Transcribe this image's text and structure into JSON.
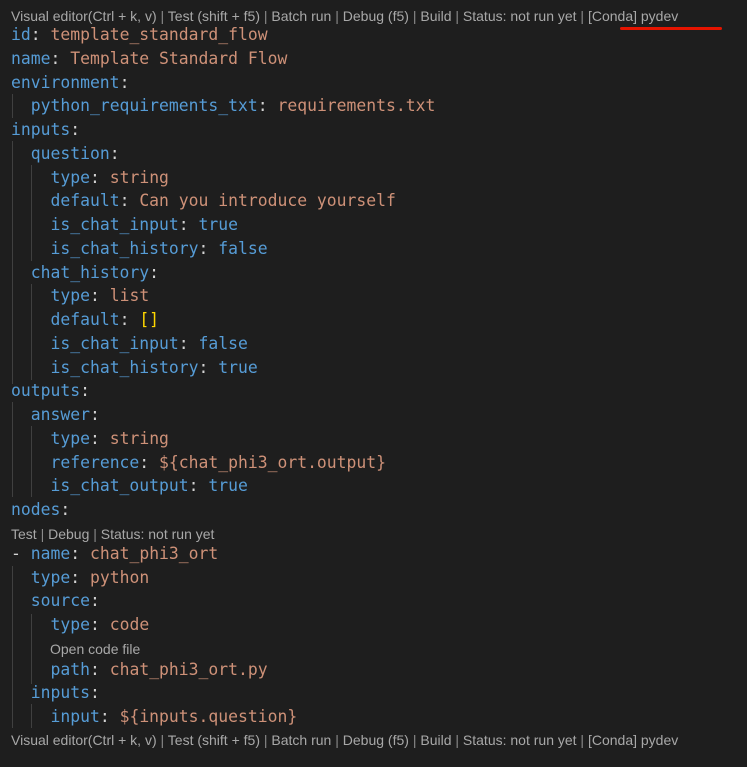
{
  "codelens": {
    "top": {
      "visual_editor": "Visual editor(Ctrl + k, v)",
      "test": "Test (shift + f5)",
      "batch_run": "Batch run",
      "debug": "Debug (f5)",
      "build": "Build",
      "status": "Status: not run yet",
      "conda": "[Conda] pydev",
      "sep": " | "
    },
    "node": {
      "test": "Test",
      "debug": "Debug",
      "status": "Status: not run yet",
      "sep": " | "
    },
    "open_code_file": "Open code file",
    "bottom": {
      "visual_editor": "Visual editor(Ctrl + k, v)",
      "test": "Test (shift + f5)",
      "batch_run": "Batch run",
      "debug": "Debug (f5)",
      "build": "Build",
      "status": "Status: not run yet",
      "conda": "[Conda] pydev",
      "sep": " | "
    }
  },
  "yaml": {
    "id_key": "id",
    "id_val": "template_standard_flow",
    "name_key": "name",
    "name_val": "Template Standard Flow",
    "environment_key": "environment",
    "python_req_key": "python_requirements_txt",
    "python_req_val": "requirements.txt",
    "inputs_key": "inputs",
    "question_key": "question",
    "q_type_key": "type",
    "q_type_val": "string",
    "q_default_key": "default",
    "q_default_val": "Can you introduce yourself",
    "q_is_chat_input_key": "is_chat_input",
    "q_is_chat_input_val": "true",
    "q_is_chat_history_key": "is_chat_history",
    "q_is_chat_history_val": "false",
    "chat_history_key": "chat_history",
    "ch_type_key": "type",
    "ch_type_val": "list",
    "ch_default_key": "default",
    "ch_default_val": "[]",
    "ch_is_chat_input_key": "is_chat_input",
    "ch_is_chat_input_val": "false",
    "ch_is_chat_history_key": "is_chat_history",
    "ch_is_chat_history_val": "true",
    "outputs_key": "outputs",
    "answer_key": "answer",
    "a_type_key": "type",
    "a_type_val": "string",
    "a_reference_key": "reference",
    "a_reference_val": "${chat_phi3_ort.output}",
    "a_is_chat_output_key": "is_chat_output",
    "a_is_chat_output_val": "true",
    "nodes_key": "nodes",
    "n_dash": "- ",
    "n_name_key": "name",
    "n_name_val": "chat_phi3_ort",
    "n_type_key": "type",
    "n_type_val": "python",
    "n_source_key": "source",
    "s_type_key": "type",
    "s_type_val": "code",
    "s_path_key": "path",
    "s_path_val": "chat_phi3_ort.py",
    "n_inputs_key": "inputs",
    "ni_input_key": "input",
    "ni_input_val": "${inputs.question}"
  },
  "colors": {
    "background": "#1e1e1e",
    "key": "#569cd6",
    "string": "#ce9178",
    "codelens": "#a8a8a8",
    "annotation_underline": "#e51400",
    "bracket": "#ffd700"
  }
}
